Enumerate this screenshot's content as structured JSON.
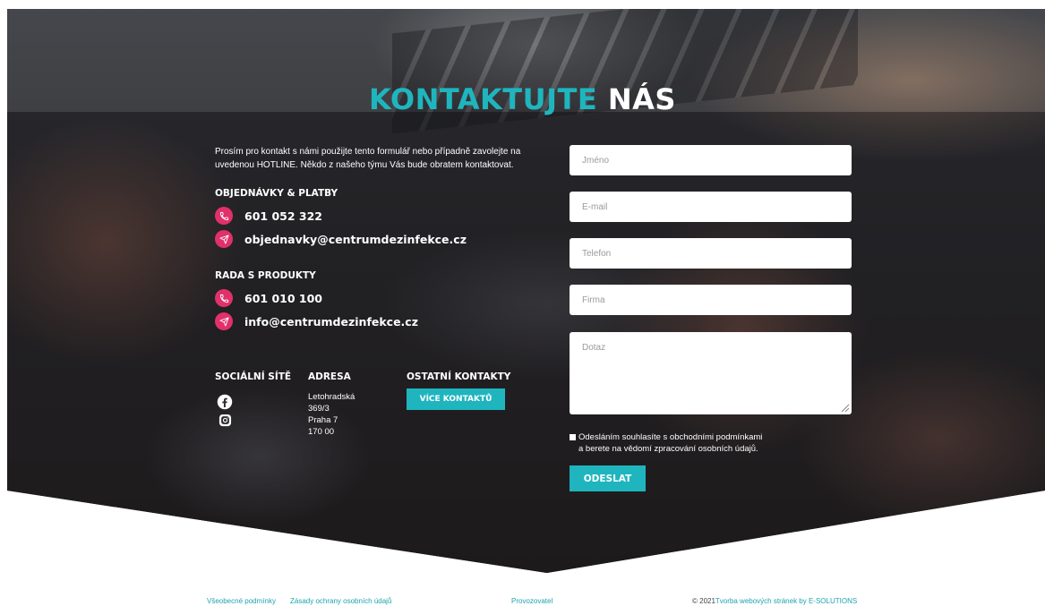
{
  "heading": {
    "part1": "KONTAKTUJTE",
    "part2": "NÁS"
  },
  "intro": "Prosím pro kontakt s námi použijte tento formulář nebo případně zavolejte na uvedenou HOTLINE. Někdo z našeho týmu Vás bude obratem kontaktovat.",
  "orders": {
    "title": "OBJEDNÁVKY & PLATBY",
    "phone": "601 052 322",
    "email": "objednavky@centrumdezinfekce.cz"
  },
  "products": {
    "title": "RADA S PRODUKTY",
    "phone": "601 010 100",
    "email": "info@centrumdezinfekce.cz"
  },
  "social": {
    "title": "SOCIÁLNÍ SÍTĚ",
    "icons": [
      "facebook-icon",
      "instagram-icon"
    ]
  },
  "address": {
    "title": "ADRESA",
    "line1": "Letohradská 369/3",
    "line2": "Praha 7",
    "line3": "170 00"
  },
  "other": {
    "title": "OSTATNÍ KONTAKTY",
    "button": "VÍCE KONTAKTŮ"
  },
  "form": {
    "name_placeholder": "Jméno",
    "email_placeholder": "E-mail",
    "phone_placeholder": "Telefon",
    "company_placeholder": "Firma",
    "question_placeholder": "Dotaz",
    "consent_line1": "Odesláním souhlasíte s obchodními podmínkami",
    "consent_line2": "a berete na vědomí zpracování osobních údajů.",
    "submit": "ODESLAT"
  },
  "footer": {
    "terms": "Všeobecné podmínky",
    "privacy": "Zásady ochrany osobních údajů",
    "operator": "Provozovatel",
    "copyright": "© 2021",
    "credit": "Tvorba webových stránek by E-SOLUTIONS"
  },
  "colors": {
    "accent": "#1fb5be",
    "pink": "#e0316b"
  }
}
